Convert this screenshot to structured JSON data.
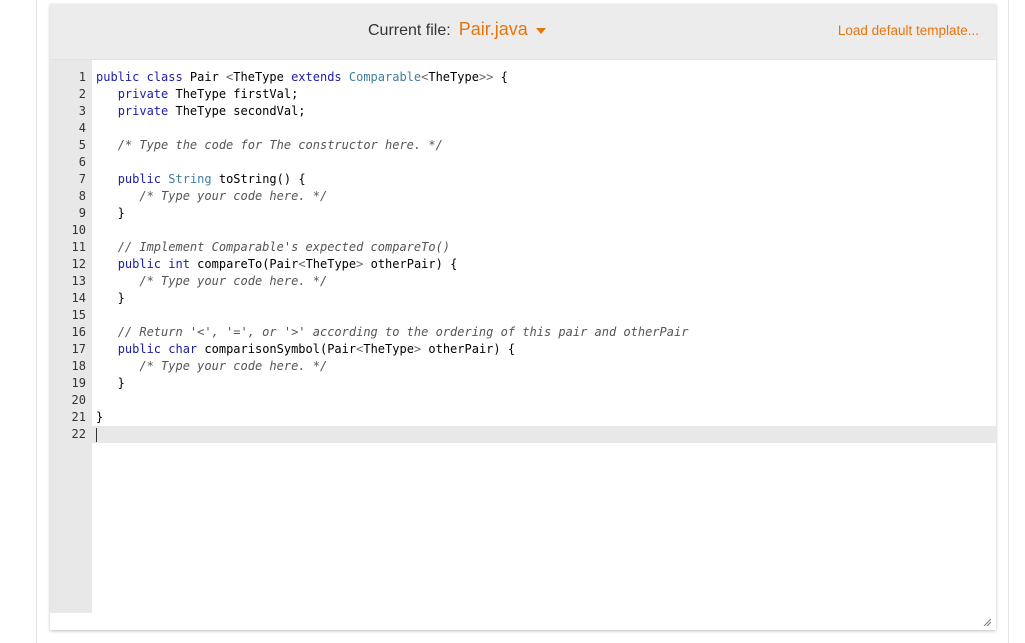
{
  "header": {
    "current_file_label": "Current file:",
    "current_file_name": "Pair.java",
    "load_template_label": "Load default template..."
  },
  "editor": {
    "cursor_line": 22,
    "lines": [
      {
        "n": "1",
        "parts": [
          [
            "kw",
            "public class "
          ],
          [
            "",
            "Pair "
          ],
          [
            "punct",
            "<"
          ],
          [
            "",
            "TheType "
          ],
          [
            "kw",
            "extends "
          ],
          [
            "ty",
            "Comparable"
          ],
          [
            "punct",
            "<"
          ],
          [
            "",
            "TheType"
          ],
          [
            "punct",
            ">>"
          ],
          [
            "",
            " {"
          ]
        ]
      },
      {
        "n": "2",
        "parts": [
          [
            "",
            "   "
          ],
          [
            "kw",
            "private "
          ],
          [
            "",
            "TheType firstVal;"
          ]
        ]
      },
      {
        "n": "3",
        "parts": [
          [
            "",
            "   "
          ],
          [
            "kw",
            "private "
          ],
          [
            "",
            "TheType secondVal;"
          ]
        ]
      },
      {
        "n": "4",
        "parts": []
      },
      {
        "n": "5",
        "parts": [
          [
            "",
            "   "
          ],
          [
            "cm",
            "/* Type the code for The constructor here. */"
          ]
        ]
      },
      {
        "n": "6",
        "parts": []
      },
      {
        "n": "7",
        "parts": [
          [
            "",
            "   "
          ],
          [
            "kw",
            "public "
          ],
          [
            "ty",
            "String "
          ],
          [
            "",
            "toString() {"
          ]
        ]
      },
      {
        "n": "8",
        "parts": [
          [
            "",
            "      "
          ],
          [
            "cm",
            "/* Type your code here. */"
          ]
        ]
      },
      {
        "n": "9",
        "parts": [
          [
            "",
            "   }"
          ]
        ]
      },
      {
        "n": "10",
        "parts": []
      },
      {
        "n": "11",
        "parts": [
          [
            "",
            "   "
          ],
          [
            "cm",
            "// Implement Comparable's expected compareTo()"
          ]
        ]
      },
      {
        "n": "12",
        "parts": [
          [
            "",
            "   "
          ],
          [
            "kw",
            "public int "
          ],
          [
            "",
            "compareTo(Pair"
          ],
          [
            "punct",
            "<"
          ],
          [
            "",
            "TheType"
          ],
          [
            "punct",
            "> "
          ],
          [
            "",
            "otherPair) {"
          ]
        ]
      },
      {
        "n": "13",
        "parts": [
          [
            "",
            "      "
          ],
          [
            "cm",
            "/* Type your code here. */"
          ]
        ]
      },
      {
        "n": "14",
        "parts": [
          [
            "",
            "   }"
          ]
        ]
      },
      {
        "n": "15",
        "parts": []
      },
      {
        "n": "16",
        "parts": [
          [
            "",
            "   "
          ],
          [
            "cm",
            "// Return '<', '=', or '>' according to the ordering of this pair and otherPair"
          ]
        ]
      },
      {
        "n": "17",
        "parts": [
          [
            "",
            "   "
          ],
          [
            "kw",
            "public char "
          ],
          [
            "",
            "comparisonSymbol(Pair"
          ],
          [
            "punct",
            "<"
          ],
          [
            "",
            "TheType"
          ],
          [
            "punct",
            "> "
          ],
          [
            "",
            "otherPair) {"
          ]
        ]
      },
      {
        "n": "18",
        "parts": [
          [
            "",
            "      "
          ],
          [
            "cm",
            "/* Type your code here. */"
          ]
        ]
      },
      {
        "n": "19",
        "parts": [
          [
            "",
            "   }"
          ]
        ]
      },
      {
        "n": "20",
        "parts": []
      },
      {
        "n": "21",
        "parts": [
          [
            "",
            "}"
          ]
        ]
      },
      {
        "n": "22",
        "parts": []
      }
    ]
  }
}
